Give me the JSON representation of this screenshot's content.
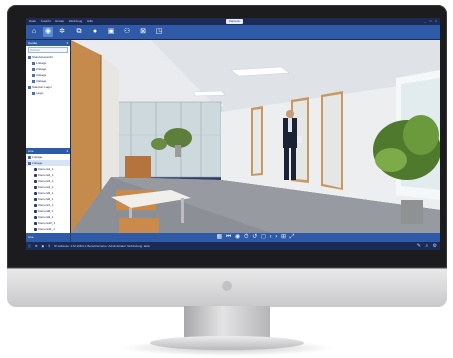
{
  "titlebar": {
    "menu": [
      "Datei",
      "Ansicht",
      "Extras",
      "Werkzeug",
      "Hilfe"
    ],
    "app_badge": "Kamera",
    "window_controls": [
      "_",
      "□",
      "×"
    ]
  },
  "toolbar": {
    "buttons": [
      {
        "icon": "home-icon",
        "glyph": "⌂"
      },
      {
        "icon": "camera-icon",
        "glyph": "◉"
      },
      {
        "icon": "settings-icon",
        "glyph": "✲"
      },
      {
        "icon": "network-icon",
        "glyph": "⧉"
      },
      {
        "icon": "user-icon",
        "glyph": "●"
      },
      {
        "icon": "building-icon",
        "glyph": "▣"
      },
      {
        "icon": "people-icon",
        "glyph": "⚇"
      },
      {
        "icon": "lock-icon",
        "glyph": "⊠"
      },
      {
        "icon": "window-icon",
        "glyph": "◳"
      }
    ]
  },
  "left_panel": {
    "devices_header": "Geräte",
    "search_placeholder": "Suchen",
    "tree": [
      {
        "label": "Standortansicht",
        "level": 1
      },
      {
        "label": "1.Etage",
        "level": 2
      },
      {
        "label": "2.Etage",
        "level": 2
      },
      {
        "label": "3.Etage",
        "level": 2
      },
      {
        "label": "4.Etage",
        "level": 2
      },
      {
        "label": "Standort Lager",
        "level": 1
      },
      {
        "label": "Lager",
        "level": 2
      }
    ],
    "live_header": "Live",
    "live_tree": [
      {
        "label": "1.Etage",
        "selected": false
      },
      {
        "label": "2.Etage",
        "selected": true
      }
    ],
    "cameras": [
      "Kamera1_1",
      "Kamera2_1",
      "Kamera3_1",
      "Kamera4_1",
      "Kamera5_1",
      "Kamera6_1",
      "Kamera7_1",
      "Kamera8_1",
      "Kamera9_1",
      "Kamera10_1",
      "Kamera11_1",
      "Kamera12_1",
      "Kamera13_1"
    ],
    "bottom_label": "Live"
  },
  "video_controls": [
    "▦",
    "⏮",
    "◉",
    "⏱",
    "↺",
    "◻",
    "‹",
    "›",
    "⊞",
    "⤢"
  ],
  "statusbar": {
    "icons": [
      "ⓘ",
      "⚙",
      "▣",
      "⚲"
    ],
    "message": "IP-Adresse: 172.168.0.1  Benutzername: Administrator  Verbindung: aktiv",
    "right_icons": [
      "✎",
      "⌕",
      "⚙"
    ]
  },
  "colors": {
    "frame_dark": "#1b2b55",
    "toolbar_blue": "#2e5aa8",
    "highlight": "#5b86d3"
  }
}
